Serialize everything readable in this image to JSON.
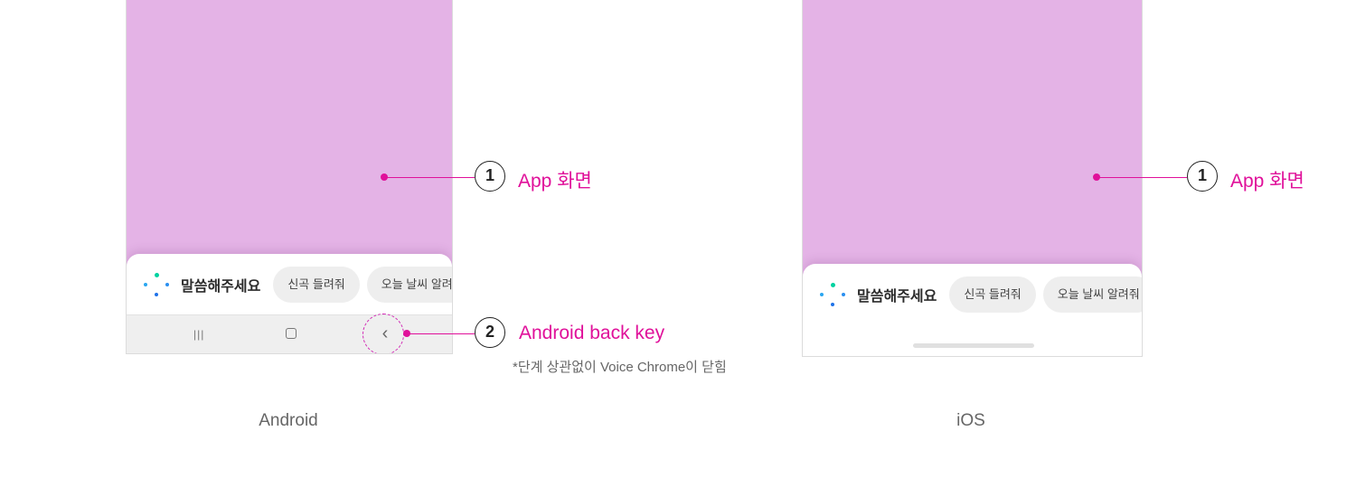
{
  "voice_chrome": {
    "prompt": "말씀해주세요",
    "android_chips": [
      "신곡 들려줘",
      "오늘 날씨 알려줘"
    ],
    "ios_chips": [
      "신곡 들려줘",
      "오늘 날씨 알려줘"
    ]
  },
  "android_nav": {
    "recent_icon": "|||",
    "back_icon": "‹"
  },
  "callouts": {
    "app_screen_number": "1",
    "app_screen_label": "App 화면",
    "back_key_number": "2",
    "back_key_label": "Android back key",
    "back_key_note": "*단계 상관없이 Voice Chrome이 닫힘"
  },
  "captions": {
    "android": "Android",
    "ios": "iOS"
  },
  "colors": {
    "app_screen": "#e4b3e6",
    "callout_accent": "#e0109a"
  }
}
